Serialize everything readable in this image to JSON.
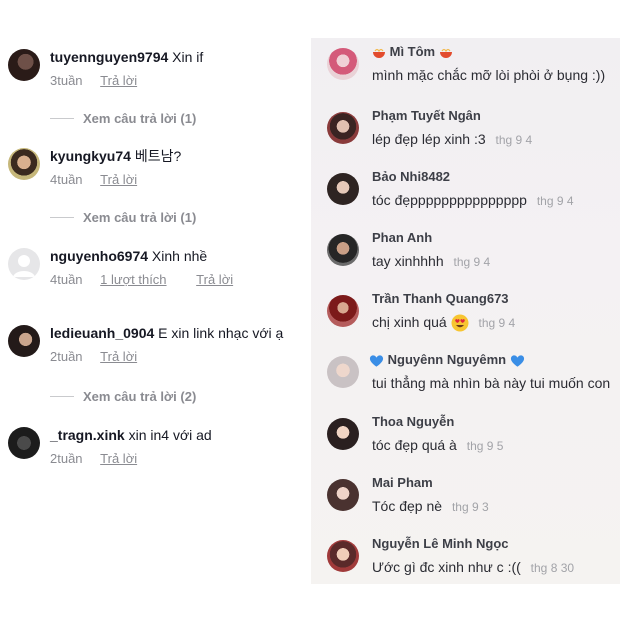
{
  "left_panel": {
    "comments": [
      {
        "username": "tuyennguyen9794",
        "text": "Xin if",
        "time": "3tuần",
        "actions": [
          "Trả lời"
        ],
        "avatar_icon": "user-avatar"
      },
      {
        "username": "kyungkyu74",
        "text": "베트남?",
        "time": "4tuần",
        "actions": [
          "Trả lời"
        ],
        "avatar_icon": "user-avatar"
      },
      {
        "username": "nguyenho6974",
        "text": "Xinh nhề",
        "time": "4tuần",
        "actions": [
          "1 lượt thích",
          "Trả lời"
        ],
        "avatar_icon": "default-avatar"
      },
      {
        "username": "ledieuanh_0904",
        "text": "E xin link nhạc với ạ",
        "time": "2tuần",
        "actions": [
          "Trả lời"
        ],
        "avatar_icon": "user-avatar"
      },
      {
        "username": "_tragn.xink",
        "text": "xin in4 với ad",
        "time": "2tuần",
        "actions": [
          "Trả lời"
        ],
        "avatar_icon": "user-avatar"
      }
    ],
    "view_replies": [
      {
        "label": "Xem câu trả lời (1)"
      },
      {
        "label": "Xem câu trả lời (1)"
      },
      {
        "label": "Xem câu trả lời (2)"
      }
    ]
  },
  "right_panel": {
    "comments": [
      {
        "username": "Mì Tôm",
        "username_emoji": "bowl-icon",
        "text": "mình mặc chắc mỡ lòi phòi ở bụng :))",
        "date": ""
      },
      {
        "username": "Phạm Tuyết Ngân",
        "text": "lép đẹp lép xinh :3",
        "date": "thg 9 4"
      },
      {
        "username": "Bảo Nhi8482",
        "text": "tóc đẹppppppppppppppp",
        "date": "thg 9 4"
      },
      {
        "username": "Phan Anh",
        "text": "tay xinhhhh",
        "date": "thg 9 4"
      },
      {
        "username": "Trần Thanh Quang673",
        "text": "chị xinh quá",
        "text_emoji": "heart-eyes-emoji",
        "date": "thg 9 4"
      },
      {
        "username": "Nguyênn Nguyêmn",
        "username_emoji": "blue-heart-icon",
        "text": "tui thẳng mà nhìn bà này tui muốn con",
        "date": ""
      },
      {
        "username": "Thoa Nguyễn",
        "text": "tóc đẹp quá à",
        "date": "thg 9 5"
      },
      {
        "username": "Mai Pham",
        "text": "Tóc đẹp nè",
        "date": "thg 9 3"
      },
      {
        "username": "Nguyễn Lê Minh Ngọc",
        "text": "Ước gì đc xinh như c :((",
        "date": "thg 8 30"
      }
    ]
  },
  "colors": {
    "primary_text": "#161823",
    "secondary_text": "#8a8b91",
    "right_bg": "#f2f0f2",
    "date_text": "#a2a3a8",
    "heart_blue": "#3a8ee6"
  }
}
